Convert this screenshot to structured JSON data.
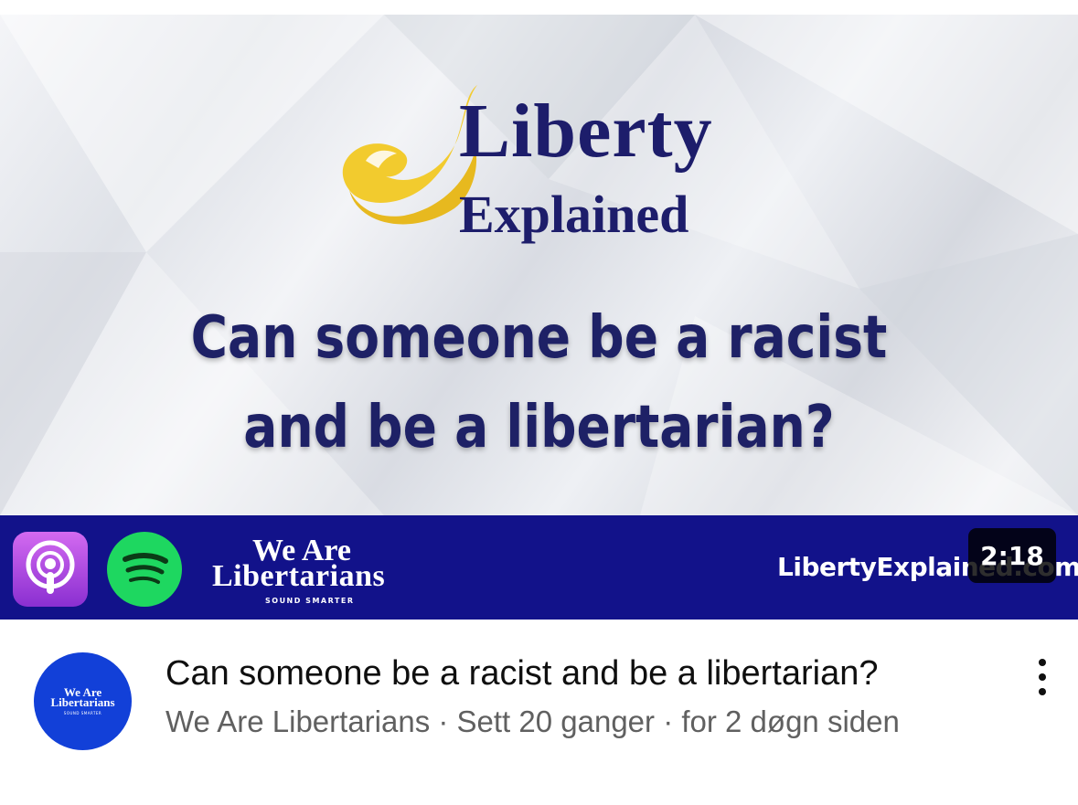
{
  "thumbnail": {
    "logo_line1": "Liberty",
    "logo_line2": "Explained",
    "question_line1": "Can someone be a racist",
    "question_line2": "and be a libertarian?",
    "banner": {
      "brand_line1": "We Are",
      "brand_line2": "Libertarians",
      "brand_tagline": "SOUND SMARTER",
      "site_url": "LibertyExplained.com",
      "icons": [
        "apple-podcasts-icon",
        "spotify-icon"
      ]
    },
    "duration": "2:18"
  },
  "video": {
    "title": "Can someone be a racist and be a libertarian?",
    "meta": "We Are Libertarians · Sett 20 ganger · for 2 døgn siden"
  },
  "channel": {
    "avatar_line1": "We Are",
    "avatar_line2": "Libertarians",
    "avatar_tagline": "SOUND SMARTER"
  },
  "colors": {
    "title_navy": "#1d1d6b",
    "banner_blue": "#12128a",
    "flame_yellow": "#f2cb2e",
    "avatar_blue": "#1240d8",
    "title_text": "#0f0f0f",
    "meta_text": "#606060"
  }
}
